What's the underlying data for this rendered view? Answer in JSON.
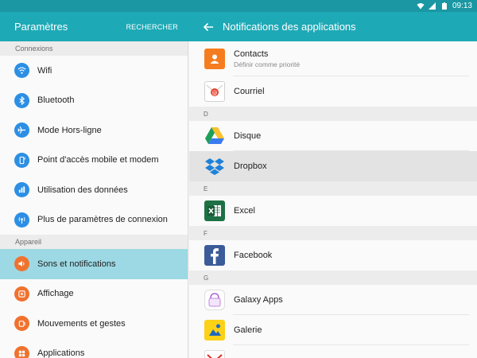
{
  "status_bar": {
    "time": "09:13"
  },
  "left_header": {
    "title": "Paramètres",
    "search_label": "RECHERCHER"
  },
  "right_header": {
    "title": "Notifications des applications"
  },
  "left_panel": {
    "sections": [
      {
        "label": "Connexions",
        "items": [
          {
            "label": "Wifi",
            "icon": "wifi-icon",
            "color": "#2c8fe4"
          },
          {
            "label": "Bluetooth",
            "icon": "bluetooth-icon",
            "color": "#2c8fe4"
          },
          {
            "label": "Mode Hors-ligne",
            "icon": "airplane-icon",
            "color": "#2c8fe4"
          },
          {
            "label": "Point d'accès mobile et modem",
            "icon": "hotspot-icon",
            "color": "#2c8fe4"
          },
          {
            "label": "Utilisation des données",
            "icon": "data-usage-icon",
            "color": "#2c8fe4"
          },
          {
            "label": "Plus de paramètres de connexion",
            "icon": "more-connections-icon",
            "color": "#2c8fe4"
          }
        ]
      },
      {
        "label": "Appareil",
        "items": [
          {
            "label": "Sons et notifications",
            "icon": "sound-icon",
            "color": "#f0722f",
            "selected": true
          },
          {
            "label": "Affichage",
            "icon": "display-icon",
            "color": "#f0722f"
          },
          {
            "label": "Mouvements et gestes",
            "icon": "gesture-icon",
            "color": "#f0722f"
          },
          {
            "label": "Applications",
            "icon": "apps-icon",
            "color": "#f0722f"
          }
        ]
      }
    ]
  },
  "right_panel": {
    "groups": [
      {
        "letter": "",
        "apps": [
          {
            "name": "Contacts",
            "sub": "Définir comme priorité",
            "icon": "contacts-icon"
          },
          {
            "name": "Courriel",
            "icon": "email-icon"
          }
        ]
      },
      {
        "letter": "D",
        "apps": [
          {
            "name": "Disque",
            "icon": "drive-icon"
          },
          {
            "name": "Dropbox",
            "icon": "dropbox-icon",
            "highlighted": true
          }
        ]
      },
      {
        "letter": "E",
        "apps": [
          {
            "name": "Excel",
            "icon": "excel-icon"
          }
        ]
      },
      {
        "letter": "F",
        "apps": [
          {
            "name": "Facebook",
            "icon": "facebook-icon"
          }
        ]
      },
      {
        "letter": "G",
        "apps": [
          {
            "name": "Galaxy Apps",
            "icon": "galaxy-apps-icon"
          },
          {
            "name": "Galerie",
            "icon": "gallery-icon"
          },
          {
            "name": "",
            "icon": "gmail-icon"
          }
        ]
      }
    ]
  },
  "colors": {
    "header": "#1ea9b6",
    "statusbar": "#1a97a3",
    "selected": "#9cd9e4"
  }
}
